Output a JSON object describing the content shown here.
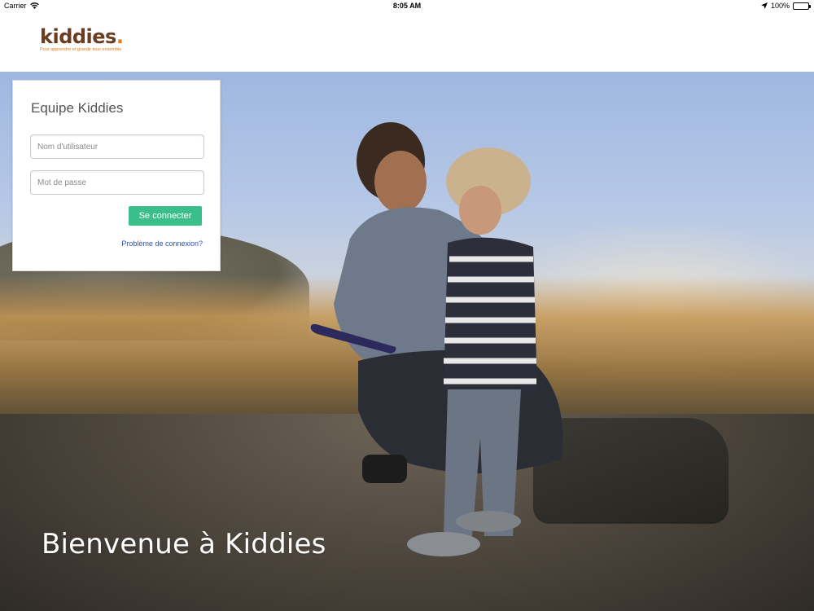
{
  "status_bar": {
    "carrier": "Carrier",
    "time": "8:05 AM",
    "battery": "100%",
    "icons": [
      "wifi-icon",
      "location-arrow-icon",
      "battery-icon"
    ]
  },
  "header": {
    "logo_text": "kiddies",
    "logo_dot": ".",
    "logo_tagline": "Pour apprendre et grandir tous ensemble",
    "colors": {
      "brand_brown": "#6b3c1f",
      "brand_orange": "#e07b1a"
    }
  },
  "login": {
    "title": "Equipe Kiddies",
    "username_placeholder": "Nom d'utilisateur",
    "password_placeholder": "Mot de passe",
    "submit_label": "Se connecter",
    "help_link": "Problème de connexion?",
    "colors": {
      "button": "#3bbf8a",
      "link": "#3350b5"
    }
  },
  "hero": {
    "welcome_text": "Bienvenue à Kiddies"
  }
}
